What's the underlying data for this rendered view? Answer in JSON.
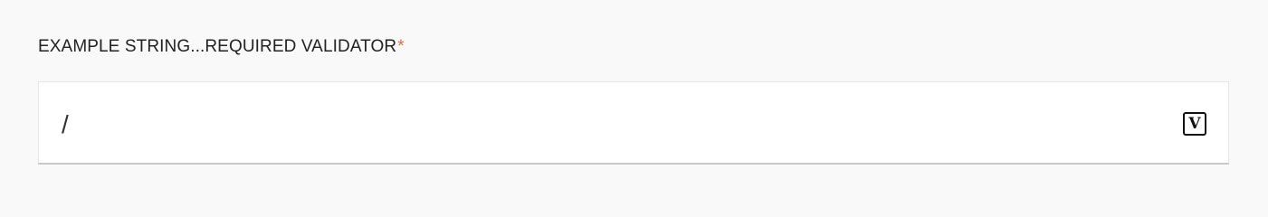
{
  "field": {
    "label": "EXAMPLE STRING...REQUIRED VALIDATOR",
    "required_mark": "*",
    "value": "/",
    "validator_icon_glyph": "V"
  },
  "colors": {
    "background": "#f9f9f9",
    "required": "#e0703c",
    "label": "#222222",
    "input_bg": "#ffffff"
  },
  "icons": {
    "validator": "validator-icon"
  }
}
